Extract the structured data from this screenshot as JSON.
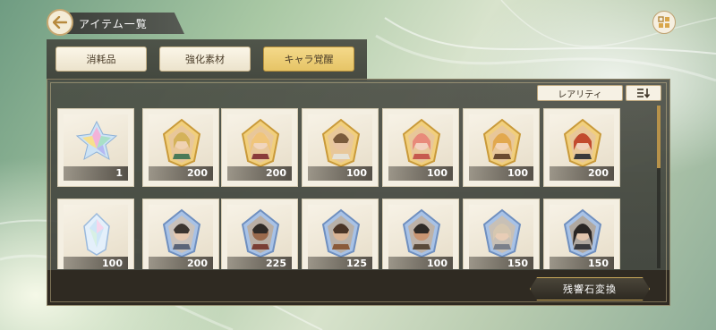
{
  "header": {
    "title": "アイテム一覧"
  },
  "tabs": [
    {
      "label": "消耗品",
      "active": false
    },
    {
      "label": "強化素材",
      "active": false
    },
    {
      "label": "キャラ覚醒",
      "active": true
    }
  ],
  "sort": {
    "label": "レアリティ",
    "order_icon": "sort-descending-icon"
  },
  "items_row1": [
    {
      "icon": "rainbow-crystal-icon",
      "count": "1"
    },
    {
      "icon": "gold-character-shard-icon",
      "count": "200"
    },
    {
      "icon": "gold-character-shard-icon",
      "count": "200"
    },
    {
      "icon": "gold-character-shard-icon",
      "count": "100"
    },
    {
      "icon": "gold-character-shard-icon",
      "count": "100"
    },
    {
      "icon": "gold-character-shard-icon",
      "count": "100"
    },
    {
      "icon": "gold-character-shard-icon",
      "count": "200"
    }
  ],
  "items_row2": [
    {
      "icon": "silver-crystal-icon",
      "count": "100"
    },
    {
      "icon": "blue-character-shard-icon",
      "count": "200"
    },
    {
      "icon": "blue-character-shard-icon",
      "count": "225"
    },
    {
      "icon": "blue-character-shard-icon",
      "count": "125"
    },
    {
      "icon": "blue-character-shard-icon",
      "count": "100"
    },
    {
      "icon": "blue-character-shard-icon",
      "count": "150"
    },
    {
      "icon": "blue-character-shard-icon",
      "count": "150"
    }
  ],
  "convert_button": "残響石変換",
  "colors": {
    "gold_frame": "#d9b25a",
    "blue_frame": "#8aa8cf",
    "panel": "#4a4c44"
  }
}
